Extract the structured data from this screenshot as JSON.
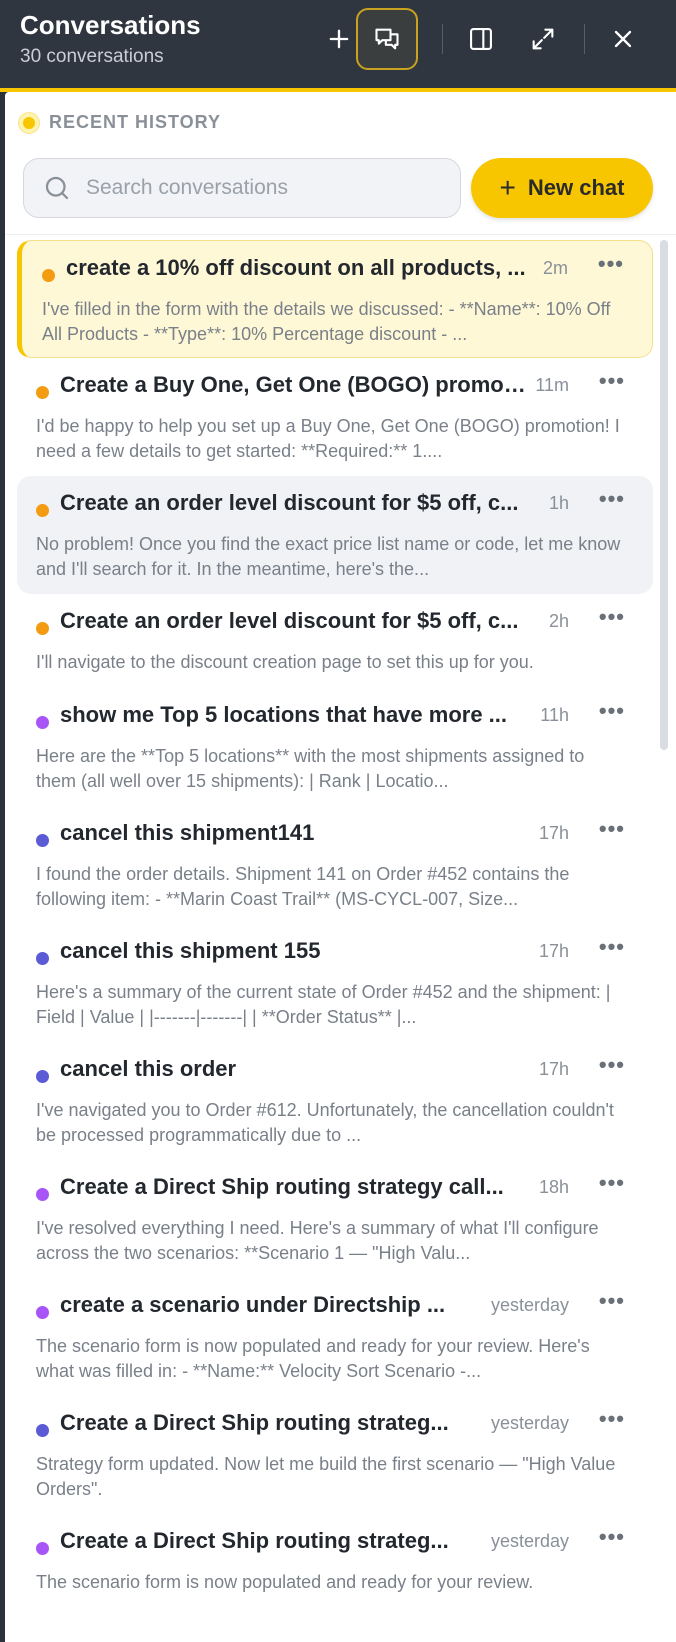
{
  "header": {
    "title": "Conversations",
    "subtitle": "30 conversations"
  },
  "section": {
    "label": "RECENT HISTORY"
  },
  "search": {
    "placeholder": "Search conversations"
  },
  "new_chat": {
    "label": "New chat"
  },
  "icons": {
    "add": "plus-icon",
    "conversations": "chat-bubbles-icon",
    "sidebar": "split-panel-icon",
    "expand": "expand-arrows-icon",
    "close": "close-icon",
    "search": "search-icon",
    "more": "more-dots-icon"
  },
  "colors": {
    "accent": "#f7c600",
    "orange": "#f39c12",
    "purple": "#a855f7",
    "indigo": "#5b5bd6"
  },
  "conversations": [
    {
      "title": "create a 10% off discount on all products, ...",
      "time": "2m",
      "preview": "I've filled in the form with the details we discussed: - **Name**: 10% Off All Products - **Type**: 10% Percentage discount - ...",
      "dot": "#f39c12"
    },
    {
      "title": "Create a Buy One, Get One (BOGO) promotion",
      "time": "11m",
      "preview": "I'd be happy to help you set up a Buy One, Get One (BOGO) promotion! I need a few details to get started: **Required:** 1....",
      "dot": "#f39c12"
    },
    {
      "title": "Create an order level discount for $5 off, c...",
      "time": "1h",
      "preview": "No problem! Once you find the exact price list name or code, let me know and I'll search for it. In the meantime, here's the...",
      "dot": "#f39c12"
    },
    {
      "title": "Create an order level discount for $5 off, c...",
      "time": "2h",
      "preview": "I'll navigate to the discount creation page to set this up for you.",
      "dot": "#f39c12"
    },
    {
      "title": "show me Top 5 locations that have more ...",
      "time": "11h",
      "preview": "Here are the **Top 5 locations** with the most shipments assigned to them (all well over 15 shipments): | Rank | Locatio...",
      "dot": "#a855f7"
    },
    {
      "title": "cancel this shipment141",
      "time": "17h",
      "preview": "I found the order details. Shipment 141 on Order #452 contains the following item: - **Marin Coast Trail** (MS-CYCL-007, Size...",
      "dot": "#5b5bd6"
    },
    {
      "title": "cancel this shipment 155",
      "time": "17h",
      "preview": "Here's a summary of the current state of Order #452 and the shipment: | Field | Value | |-------|-------| | **Order Status** |...",
      "dot": "#5b5bd6"
    },
    {
      "title": "cancel this order",
      "time": "17h",
      "preview": "I've navigated you to Order #612. Unfortunately, the cancellation couldn't be processed programmatically due to ...",
      "dot": "#5b5bd6"
    },
    {
      "title": "Create a Direct Ship routing strategy call...",
      "time": "18h",
      "preview": "I've resolved everything I need. Here's a summary of what I'll configure across the two scenarios: **Scenario 1 — \"High Valu...",
      "dot": "#a855f7"
    },
    {
      "title": "create a scenario under Directship ...",
      "time": "yesterday",
      "preview": "The scenario form is now populated and ready for your review. Here's what was filled in: - **Name:** Velocity Sort Scenario -...",
      "dot": "#a855f7"
    },
    {
      "title": "Create a Direct Ship routing strateg...",
      "time": "yesterday",
      "preview": "Strategy form updated. Now let me build the first scenario — \"High Value Orders\".",
      "dot": "#5b5bd6"
    },
    {
      "title": "Create a Direct Ship routing strateg...",
      "time": "yesterday",
      "preview": "The scenario form is now populated and ready for your review.",
      "dot": "#a855f7"
    }
  ]
}
